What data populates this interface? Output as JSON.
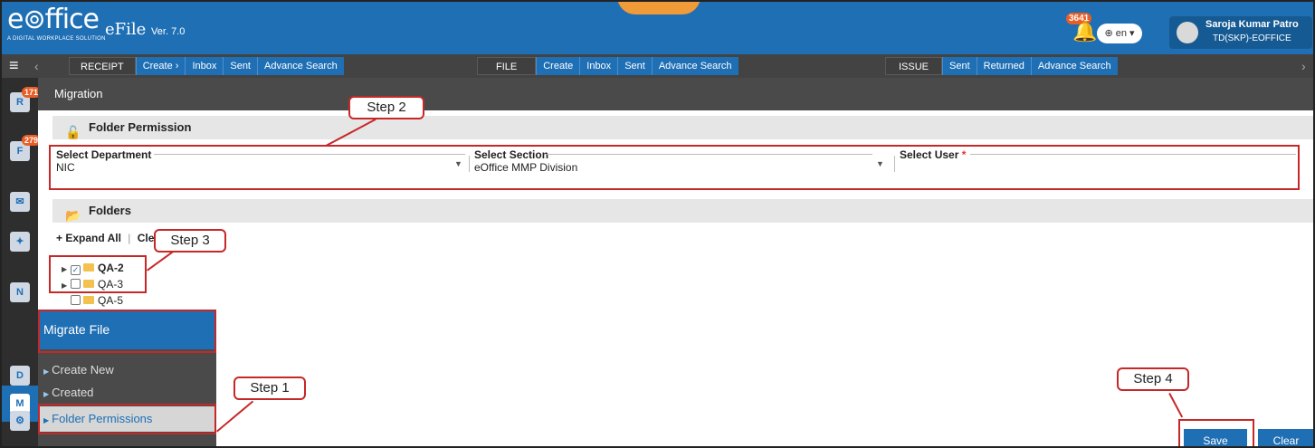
{
  "header": {
    "logo_main": "e⊚ffice",
    "logo_sub": "A DIGITAL WORKPLACE SOLUTION",
    "app_name": "eFile",
    "version": "Ver. 7.0",
    "notification_count": "3641",
    "language": "⊕ en ▾",
    "user_name": "Saroja Kumar Patro",
    "user_role": "TD(SKP)-EOFFICE"
  },
  "nav": {
    "receipt": {
      "head": "RECEIPT",
      "items": [
        "Create ›",
        "Inbox",
        "Sent",
        "Advance Search"
      ]
    },
    "file": {
      "head": "FILE",
      "items": [
        "Create",
        "Inbox",
        "Sent",
        "Advance Search"
      ]
    },
    "issue": {
      "head": "ISSUE",
      "items": [
        "Sent",
        "Returned",
        "Advance Search"
      ]
    }
  },
  "rail": {
    "receipt_badge": "171",
    "file_badge": "279",
    "icons": [
      "receipt-icon",
      "file-icon",
      "dak-icon",
      "admin-icon",
      "notification-icon",
      "migrate-icon",
      "dsc-icon",
      "settings-icon"
    ]
  },
  "page": {
    "title": "Migration",
    "folder_permission_title": "Folder Permission",
    "department_label": "Select Department",
    "department_value": "NIC",
    "section_label": "Select Section",
    "section_value": "eOffice MMP Division",
    "user_label": "Select User",
    "user_required": "*",
    "user_value": "",
    "folders_title": "Folders",
    "expand_all": "+ Expand All",
    "clear_label": "Cle",
    "folders": [
      {
        "name": "QA-2",
        "checked": true,
        "has_children": true
      },
      {
        "name": "QA-3",
        "checked": false,
        "has_children": true
      },
      {
        "name": "QA-5",
        "checked": false,
        "has_children": false
      }
    ],
    "save": "Save",
    "clear": "Clear"
  },
  "menu": {
    "title": "Migrate File",
    "items": [
      "Create New",
      "Created"
    ],
    "active_item": "Folder Permissions"
  },
  "annotations": {
    "step1": "Step 1",
    "step2": "Step 2",
    "step3": "Step 3",
    "step4": "Step 4"
  },
  "colors": {
    "brand_blue": "#1f6fb5",
    "nav_dark": "#434343",
    "annotation_red": "#c62828"
  }
}
